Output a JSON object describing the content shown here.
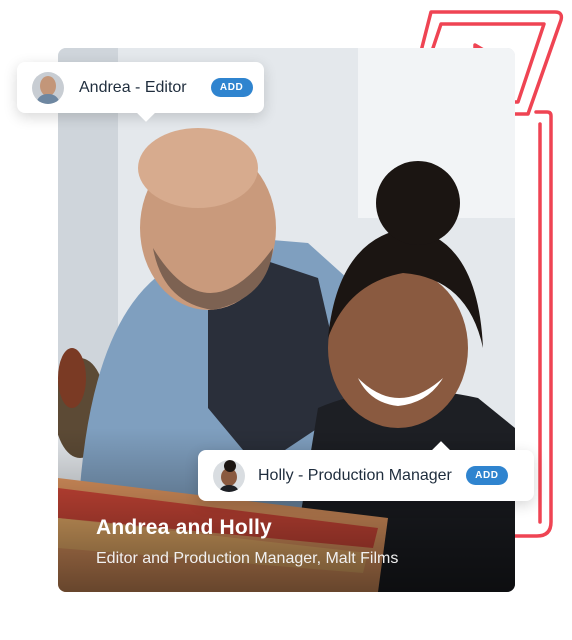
{
  "photo": {
    "caption_title": "Andrea and Holly",
    "caption_subtitle": "Editor and Production Manager, Malt Films"
  },
  "tags": {
    "andrea": {
      "name": "Andrea - Editor",
      "button_label": "ADD"
    },
    "holly": {
      "name": "Holly - Production Manager",
      "button_label": "ADD"
    }
  },
  "colors": {
    "accent_red": "#ef4453",
    "button_blue": "#2f84cf",
    "tag_text": "#1f2d3d"
  },
  "icons": {
    "decoration": "play-laptop-outline-icon"
  }
}
